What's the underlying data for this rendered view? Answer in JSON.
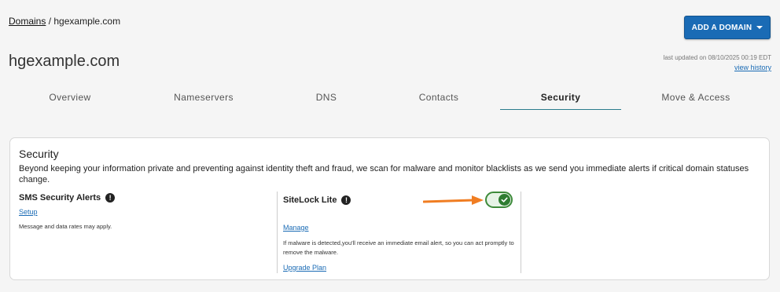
{
  "breadcrumb": {
    "root": "Domains",
    "separator": " / ",
    "current": "hgexample.com"
  },
  "header": {
    "add_domain_label": "ADD A DOMAIN",
    "domain_title": "hgexample.com",
    "last_updated": "last updated on 08/10/2025 00:19 EDT",
    "view_history": "view history"
  },
  "tabs": [
    "Overview",
    "Nameservers",
    "DNS",
    "Contacts",
    "Security",
    "Move & Access"
  ],
  "active_tab": "Security",
  "security": {
    "title": "Security",
    "description": "Beyond keeping your information private and preventing against identity theft and fraud, we scan for malware and monitor blacklists as we send you immediate alerts if critical domain statuses change.",
    "sms": {
      "title": "SMS Security Alerts",
      "setup": "Setup",
      "note": "Message and data rates may apply."
    },
    "sitelock": {
      "title": "SiteLock Lite",
      "enabled": true,
      "manage": "Manage",
      "note": "If malware is detected,you'll receive an immediate email alert, so you can act promptly to remove the malware.",
      "upgrade": "Upgrade Plan"
    }
  },
  "colors": {
    "accent": "#1a6bb5",
    "toggle_on": "#2f7d32",
    "annotation_arrow": "#f07d22"
  }
}
